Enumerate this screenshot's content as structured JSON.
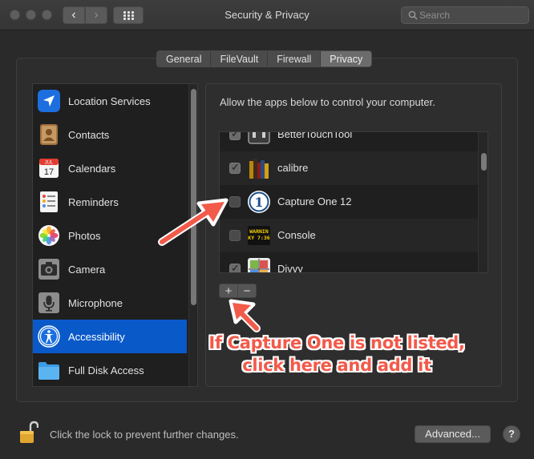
{
  "window": {
    "title": "Security & Privacy"
  },
  "search": {
    "placeholder": "Search"
  },
  "tabs": [
    {
      "label": "General",
      "active": false
    },
    {
      "label": "FileVault",
      "active": false
    },
    {
      "label": "Firewall",
      "active": false
    },
    {
      "label": "Privacy",
      "active": true
    }
  ],
  "sidebar": {
    "items": [
      {
        "label": "Location Services",
        "icon": "location-arrow-icon"
      },
      {
        "label": "Contacts",
        "icon": "contacts-book-icon"
      },
      {
        "label": "Calendars",
        "icon": "calendar-icon",
        "calendar_month": "JUL",
        "calendar_day": "17"
      },
      {
        "label": "Reminders",
        "icon": "reminders-list-icon"
      },
      {
        "label": "Photos",
        "icon": "photos-flower-icon"
      },
      {
        "label": "Camera",
        "icon": "camera-icon"
      },
      {
        "label": "Microphone",
        "icon": "microphone-icon"
      },
      {
        "label": "Accessibility",
        "icon": "accessibility-icon",
        "selected": true
      },
      {
        "label": "Full Disk Access",
        "icon": "folder-icon"
      }
    ]
  },
  "privacy_panel": {
    "description": "Allow the apps below to control your computer.",
    "apps": [
      {
        "label": "BetterTouchTool",
        "checked": true,
        "icon": "bettertouchtool-icon"
      },
      {
        "label": "calibre",
        "checked": true,
        "icon": "calibre-books-icon"
      },
      {
        "label": "Capture One 12",
        "checked": false,
        "icon": "capture-one-icon",
        "icon_text": "1"
      },
      {
        "label": "Console",
        "checked": false,
        "icon": "console-icon",
        "icon_text_1": "WARNIN",
        "icon_text_2": "KY 7:36"
      },
      {
        "label": "Divvy",
        "checked": true,
        "icon": "divvy-grid-icon"
      }
    ],
    "add_label": "+",
    "remove_label": "−"
  },
  "annotation": {
    "line1": "If Capture One is not listed,",
    "line2": "click here and add it",
    "color": "#f25a4a"
  },
  "footer": {
    "lock_text": "Click the lock to prevent further changes.",
    "advanced_label": "Advanced...",
    "help_label": "?"
  },
  "colors": {
    "accent": "#0a59c9",
    "window_bg": "#2a2a2a",
    "list_bg": "#1f1f1f"
  }
}
